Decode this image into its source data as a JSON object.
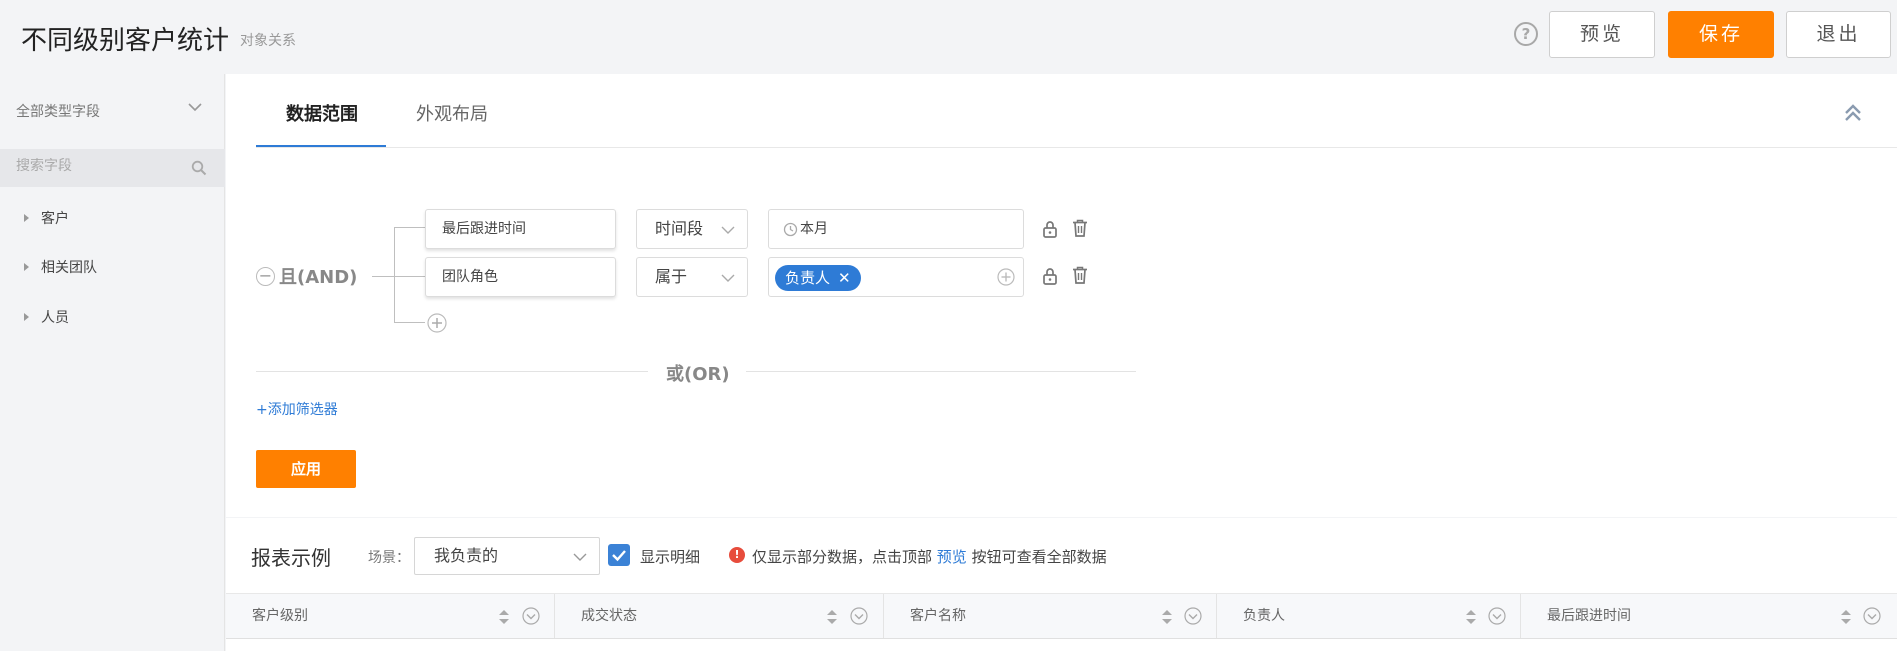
{
  "header": {
    "title": "不同级别客户统计",
    "subtitle": "对象关系",
    "help_glyph": "?",
    "preview_label": "预览",
    "save_label": "保存",
    "exit_label": "退出"
  },
  "sidebar": {
    "type_selector": "全部类型字段",
    "search_placeholder": "搜索字段",
    "items": [
      {
        "label": "客户"
      },
      {
        "label": "相关团队"
      },
      {
        "label": "人员"
      }
    ]
  },
  "tabs": [
    {
      "label": "数据范围",
      "active": true
    },
    {
      "label": "外观布局",
      "active": false
    }
  ],
  "filter": {
    "group_operator": "且(AND)",
    "minus_glyph": "−",
    "conditions": [
      {
        "field": "最后跟进时间",
        "operator": "时间段",
        "value": "本月",
        "value_type": "time"
      },
      {
        "field": "团队角色",
        "operator": "属于",
        "value": "负责人",
        "value_type": "tag"
      }
    ],
    "tag_remove_glyph": "✕",
    "or_label": "或(OR)",
    "add_filter_label": "+添加筛选器",
    "apply_label": "应用"
  },
  "report": {
    "title": "报表示例",
    "scene_label": "场景：",
    "scene_value": "我负责的",
    "show_detail_label": "显示明细",
    "show_detail_checked": true,
    "warning_glyph": "!",
    "warning_prefix": "仅显示部分数据，点击顶部",
    "warning_link": "预览",
    "warning_suffix": "按钮可查看全部数据",
    "columns": [
      "客户级别",
      "成交状态",
      "客户名称",
      "负责人",
      "最后跟进时间"
    ]
  },
  "colors": {
    "accent_orange": "#ff8000",
    "accent_blue": "#2e7bd6",
    "warning_red": "#e74c3c"
  }
}
